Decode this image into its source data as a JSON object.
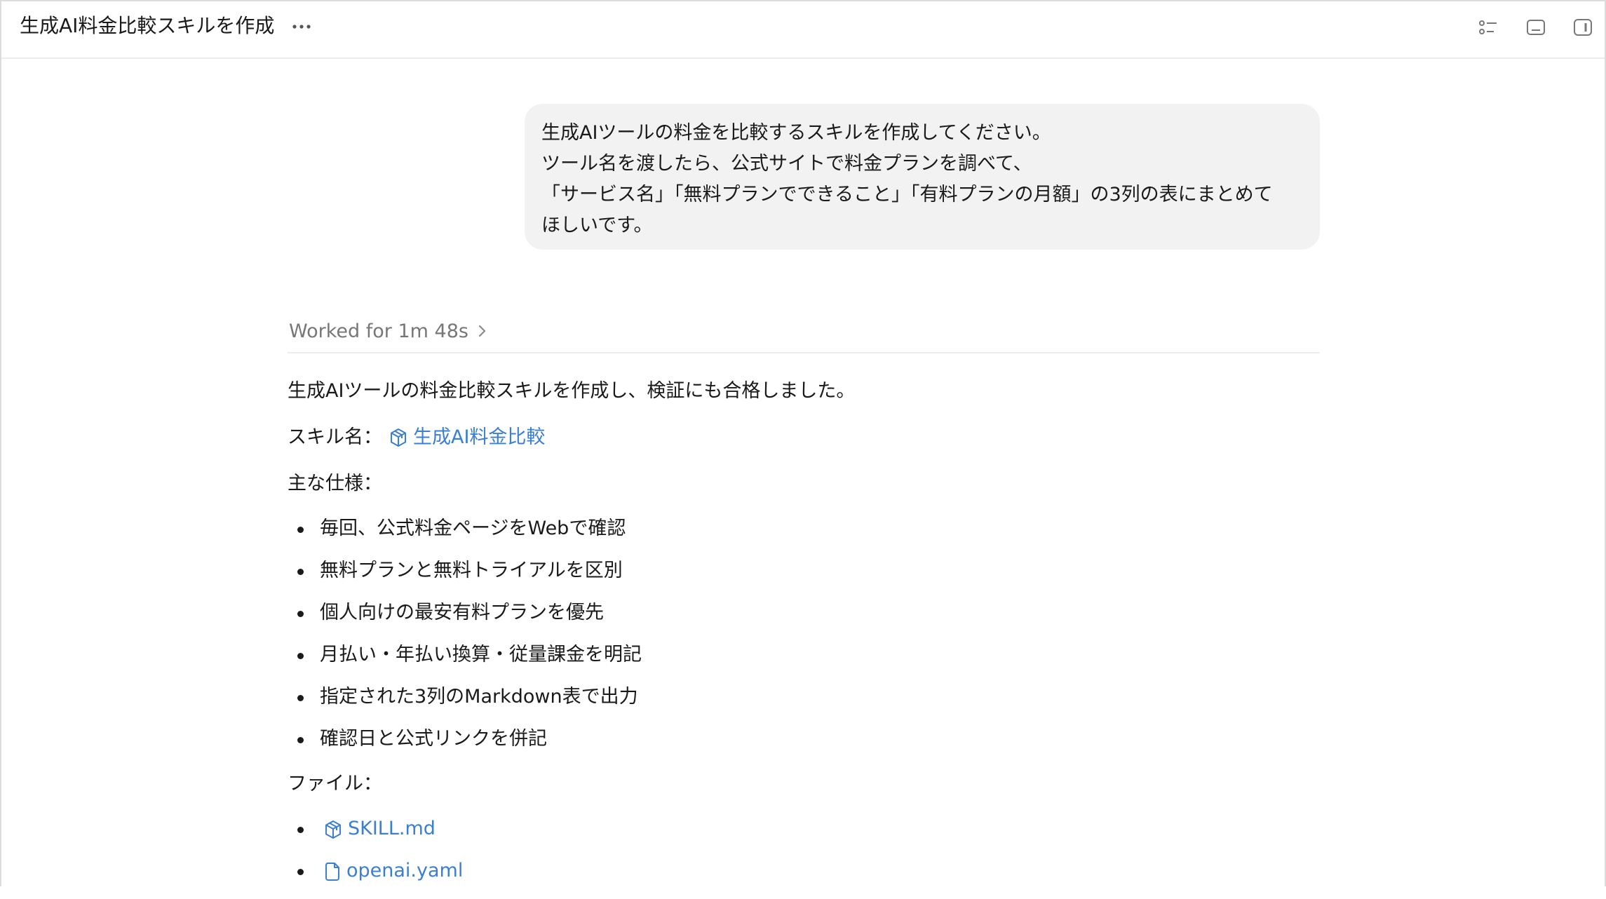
{
  "header": {
    "title": "生成AI料金比較スキルを作成",
    "more_icon": "more-horizontal-icon",
    "right_icons": [
      "checklist-icon",
      "terminal-panel-icon",
      "side-panel-icon"
    ]
  },
  "user_message": {
    "lines": [
      "生成AIツールの料金を比較するスキルを作成してください。",
      "ツール名を渡したら、公式サイトで料金プランを調べて、",
      "「サービス名」「無料プランでできること」「有料プランの月額」の3列の表にまとめて",
      "ほしいです。"
    ]
  },
  "worked": {
    "label": "Worked for 1m 48s"
  },
  "response": {
    "intro": "生成AIツールの料金比較スキルを作成し、検証にも合格しました。",
    "skill_label": "スキル名：",
    "skill_name": "生成AI料金比較",
    "spec_label": "主な仕様：",
    "spec_items": [
      "毎回、公式料金ページをWebで確認",
      "無料プランと無料トライアルを区別",
      "個人向けの最安有料プランを優先",
      "月払い・年払い換算・従量課金を明記",
      "指定された3列のMarkdown表で出力",
      "確認日と公式リンクを併記"
    ],
    "files_label": "ファイル：",
    "files": [
      "SKILL.md",
      "openai.yaml"
    ]
  },
  "colors": {
    "link": "#3b7fd0",
    "bubble": "#f2f2f2",
    "muted": "#777777"
  }
}
